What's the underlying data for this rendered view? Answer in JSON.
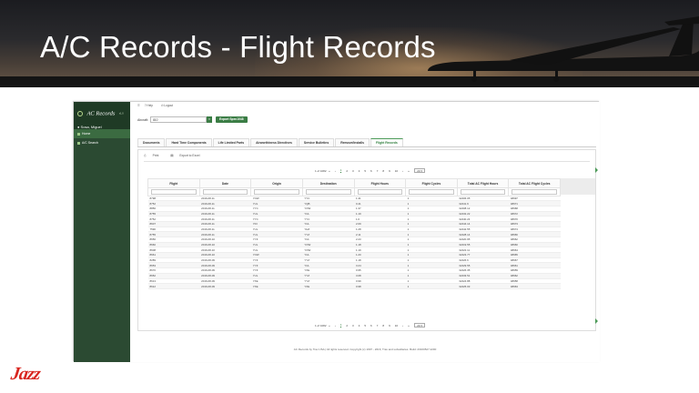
{
  "slide": {
    "title": "A/C Records - Flight Records",
    "brand": "Jazz",
    "brand_color": "#d8261f"
  },
  "sidebar": {
    "app_title": "AC Records",
    "version": "v1.0",
    "user": "Sosa, Miguel",
    "items": [
      {
        "label": "Home",
        "active": true
      },
      {
        "label": "A/C Search",
        "active": false
      }
    ]
  },
  "topbar": {
    "links": [
      "Help",
      "Logout"
    ]
  },
  "aircraft": {
    "label": "Aircraft:",
    "value": "810",
    "export_spec_label": "Export Spec1048"
  },
  "tabs": [
    {
      "label": "Documents",
      "active": false
    },
    {
      "label": "Hard Time Components",
      "active": false
    },
    {
      "label": "Life Limited Parts",
      "active": false
    },
    {
      "label": "Airworthiness Directives",
      "active": false
    },
    {
      "label": "Service Bulletins",
      "active": false
    },
    {
      "label": "Remove/Installs",
      "active": false
    },
    {
      "label": "Flight Records",
      "active": true
    }
  ],
  "actions": {
    "print": "Print",
    "export": "Export to Excel"
  },
  "pager": {
    "summary": "1 of 1082",
    "pages": [
      "1",
      "2",
      "3",
      "4",
      "5",
      "6",
      "7",
      "8",
      "9",
      "10"
    ],
    "page_size": "20"
  },
  "table": {
    "columns": [
      "Flight",
      "Date",
      "Origin",
      "Destination",
      "Flight Hours",
      "Flight Cycles",
      "Total AC Flight Hours",
      "Total AC Flight Cycles"
    ],
    "rows": [
      [
        "8798",
        "2016-08-11",
        "YOW",
        "YYC",
        "1.41",
        "1",
        "32406.05",
        "48997"
      ],
      [
        "8752",
        "2016-08-11",
        "YUL",
        "YQB",
        "0.41",
        "1",
        "32441.9",
        "48971"
      ],
      [
        "8856",
        "2016-08-11",
        "YYC",
        "YOW",
        "1.37",
        "1",
        "32408.12",
        "48968"
      ],
      [
        "8755",
        "2016-08-11",
        "YUL",
        "YUL",
        "1.19",
        "1",
        "32432.22",
        "48972"
      ],
      [
        "8752",
        "2016-08-11",
        "YYC",
        "YYC",
        "1.6",
        "1",
        "32440.24",
        "48970"
      ],
      [
        "8607",
        "2016-08-11",
        "YDI",
        "YUL",
        "2.09",
        "1",
        "32444.14",
        "48973"
      ],
      [
        "7590",
        "2016-08-11",
        "YUL",
        "YHZ",
        "1.28",
        "1",
        "32442.55",
        "48974"
      ],
      [
        "8755",
        "2016-08-11",
        "YUL",
        "YYZ",
        "2.11",
        "1",
        "32428.14",
        "48966"
      ],
      [
        "8656",
        "2016-08-10",
        "YYZ",
        "YUL",
        "2.23",
        "1",
        "32420.95",
        "48962"
      ],
      [
        "8660",
        "2016-08-10",
        "YUL",
        "YOW",
        "1.18",
        "1",
        "32419.55",
        "48960"
      ],
      [
        "8608",
        "2016-08-10",
        "YUL",
        "YOW",
        "1.19",
        "1",
        "32422.11",
        "48964"
      ],
      [
        "8661",
        "2016-08-10",
        "YOW",
        "YUL",
        "1.20",
        "1",
        "32423.77",
        "48965"
      ],
      [
        "8289",
        "2016-08-09",
        "YYZ",
        "YYZ",
        "1.18",
        "1",
        "32426.6",
        "48967"
      ],
      [
        "8653",
        "2016-08-09",
        "YYZ",
        "YUL",
        "3.24",
        "1",
        "32429.55",
        "48961"
      ],
      [
        "8670",
        "2016-08-09",
        "YYZ",
        "YXE",
        "0.95",
        "1",
        "32426.35",
        "48959"
      ],
      [
        "8652",
        "2016-08-09",
        "YUL",
        "YYZ",
        "3.08",
        "1",
        "32433.51",
        "48962"
      ],
      [
        "8613",
        "2016-08-09",
        "YXE",
        "YYZ",
        "0.99",
        "1",
        "32424.88",
        "48958"
      ],
      [
        "8612",
        "2016-08-09",
        "YXE",
        "YXE",
        "0.98",
        "1",
        "32425.03",
        "48963"
      ]
    ]
  },
  "footer": {
    "text": "AC Records by Trax USA | All rights reserved. Copyright (c) 1997 - 2016, Trax and subsidiaries. Build: 20160527.2200"
  }
}
